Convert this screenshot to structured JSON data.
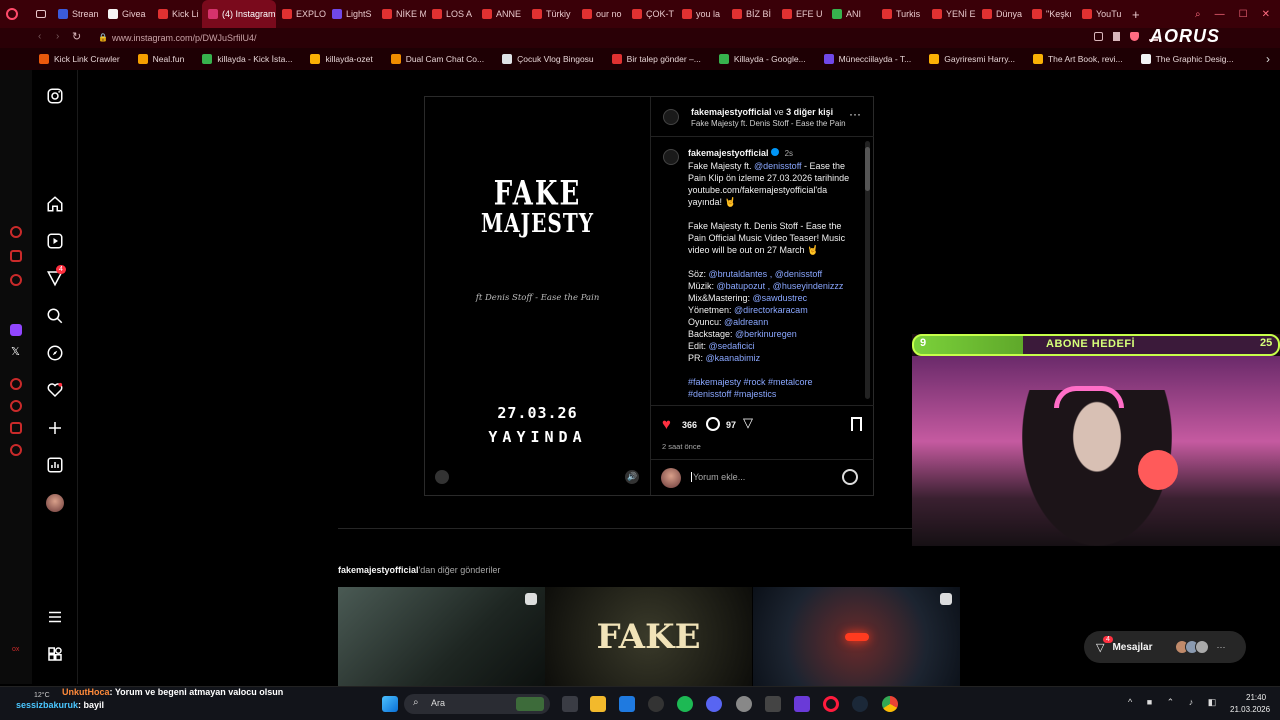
{
  "browser": {
    "tabs": [
      {
        "label": "Strean",
        "color": "#3b5bdb"
      },
      {
        "label": "Givea",
        "color": "#f5f5f5"
      },
      {
        "label": "Kick Li",
        "color": "#e03131"
      },
      {
        "label": "(4) Instagram",
        "color": "#d6336c",
        "active": true
      },
      {
        "label": "EXPLO",
        "color": "#e03131"
      },
      {
        "label": "LightS",
        "color": "#7048e8"
      },
      {
        "label": "NİKE M",
        "color": "#e03131"
      },
      {
        "label": "LOS A",
        "color": "#e03131"
      },
      {
        "label": "ANNE",
        "color": "#e03131"
      },
      {
        "label": "Türkiy",
        "color": "#e03131"
      },
      {
        "label": "our no",
        "color": "#e03131"
      },
      {
        "label": "ÇOK-T",
        "color": "#e03131"
      },
      {
        "label": "you la",
        "color": "#e03131"
      },
      {
        "label": "BİZ Bİ",
        "color": "#e03131"
      },
      {
        "label": "EFE U",
        "color": "#e03131"
      },
      {
        "label": "ANI",
        "color": "#37b24d"
      },
      {
        "label": "Turkis",
        "color": "#e03131"
      },
      {
        "label": "YENİ E",
        "color": "#e03131"
      },
      {
        "label": "Dünya",
        "color": "#e03131"
      },
      {
        "label": "\"Keşkı",
        "color": "#e03131"
      },
      {
        "label": "YouTu",
        "color": "#e03131"
      }
    ],
    "url": "www.instagram.com/p/DWJuSrfilU4/",
    "brand": "AORUS",
    "bookmarks": [
      {
        "label": "Kick Link Crawler",
        "color": "#e8590c"
      },
      {
        "label": "Neal.fun",
        "color": "#f59f00"
      },
      {
        "label": "killayda - Kick İsta...",
        "color": "#37b24d"
      },
      {
        "label": "killayda-ozet",
        "color": "#fab005"
      },
      {
        "label": "Dual Cam Chat Co...",
        "color": "#f08c00"
      },
      {
        "label": "Çocuk Vlog Bingosu",
        "color": "#dee2e6"
      },
      {
        "label": "Bir talep gönder –...",
        "color": "#e03131"
      },
      {
        "label": "Killayda - Google...",
        "color": "#37b24d"
      },
      {
        "label": "Münecciilayda - T...",
        "color": "#7048e8"
      },
      {
        "label": "Gayriresmi Harry...",
        "color": "#fab005"
      },
      {
        "label": "The Art Book, revi...",
        "color": "#fab005"
      },
      {
        "label": "The Graphic Desig...",
        "color": "#f1f3f5"
      }
    ]
  },
  "nav": {
    "notification_count": "4"
  },
  "post": {
    "media": {
      "logo_line1": "FAKE",
      "logo_line2": "MAJESTY",
      "script_text": "ft Denis Stoff - Ease the Pain",
      "date_text": "27.03.26",
      "release_text": "YAYINDA"
    },
    "header": {
      "handle": "fakemajestyofficial",
      "conj": "ve",
      "others": "3 diğer kişi",
      "subtitle": "Fake Majesty ft. Denis Stoff - Ease the Pain"
    },
    "caption": {
      "handle": "fakemajestyofficial",
      "time": "2s",
      "lines": [
        {
          "t": "Fake Majesty ft. ",
          "l": "@denisstoff",
          "r": " - Ease the"
        },
        {
          "t": "Pain Klip ön izleme 27.03.2026 tarihinde",
          "l": "",
          "r": ""
        },
        {
          "t": "youtube.com/fakemajestyofficial'da",
          "l": "",
          "r": ""
        },
        {
          "t": "yayında! 🤘",
          "l": "",
          "r": ""
        },
        {
          "t": "",
          "l": "",
          "r": ""
        },
        {
          "t": "Fake Majesty ft. Denis Stoff - Ease the",
          "l": "",
          "r": ""
        },
        {
          "t": "Pain Official Music Video Teaser! Music",
          "l": "",
          "r": ""
        },
        {
          "t": "video will be out on 27 March 🤘",
          "l": "",
          "r": ""
        },
        {
          "t": "",
          "l": "",
          "r": ""
        },
        {
          "t": "Söz: ",
          "l": "@brutaldantes , @denisstoff",
          "r": ""
        },
        {
          "t": "Müzik: ",
          "l": "@batupozut , @huseyindenizzz",
          "r": ""
        },
        {
          "t": "Mix&Mastering: ",
          "l": "@sawdustrec",
          "r": ""
        },
        {
          "t": "Yönetmen: ",
          "l": "@directorkaracam",
          "r": ""
        },
        {
          "t": "Oyuncu: ",
          "l": "@aldreann",
          "r": ""
        },
        {
          "t": "Backstage: ",
          "l": "@berkinuregen",
          "r": ""
        },
        {
          "t": "Edit: ",
          "l": "@sedaficici",
          "r": ""
        },
        {
          "t": "PR: ",
          "l": "@kaanabimiz",
          "r": ""
        },
        {
          "t": "",
          "l": "",
          "r": ""
        },
        {
          "t": "",
          "l": "#fakemajesty #rock #metalcore",
          "r": ""
        },
        {
          "t": "",
          "l": "#denisstoff #majestics",
          "r": ""
        }
      ]
    },
    "likes": "366",
    "comments": "97",
    "posted": "2 saat önce",
    "comment_placeholder": "Yorum ekle..."
  },
  "more": {
    "handle": "fakemajestyofficial",
    "suffix": "'dan diğer gönderiler"
  },
  "messages": {
    "label": "Mesajlar",
    "badge": "4"
  },
  "overlay": {
    "goal_current": "9",
    "goal_label": "ABONE HEDEFİ",
    "goal_target": "25"
  },
  "chat": {
    "line1_user": "UnkutHoca",
    "line1_text": ": Yorum ve begeni atmayan valocu olsun",
    "line2_user": "sessizbakuruk",
    "line2_text": ": bayil",
    "weather": "12°C"
  },
  "taskbar": {
    "search": "Ara",
    "time": "21:40",
    "date": "21.03.2026"
  }
}
